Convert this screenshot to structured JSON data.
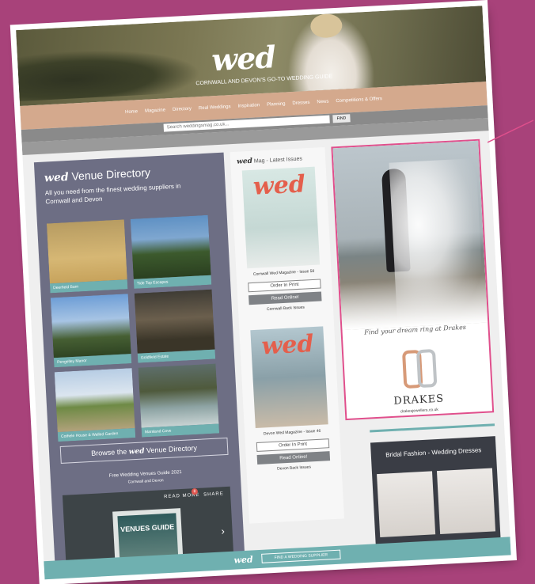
{
  "header": {
    "logo": "wed",
    "tagline": "CORNWALL AND DEVON'S GO-TO WEDDING GUIDE",
    "nav": [
      "Home",
      "Magazine",
      "Directory",
      "Real Weddings",
      "Inspiration",
      "Planning",
      "Dresses",
      "News",
      "Competitions & Offers"
    ],
    "search_placeholder": "Search weddingsmag.co.uk...",
    "find_label": "FIND"
  },
  "venue_directory": {
    "logo": "wed",
    "title": "Venue Directory",
    "subtitle": "All you need from the finest wedding suppliers in Cornwall and Devon",
    "venues": [
      "Deerfield Barn",
      "Tide Top Escapes",
      "Pengelley Manor",
      "Goldfield Estate",
      "Cothele House & Walled Garden",
      "Marsland Cove"
    ],
    "browse_prefix": "Browse the",
    "browse_logo": "wed",
    "browse_suffix": "Venue Directory",
    "guide_title": "Free Wedding Venues Guide 2021",
    "guide_sub": "Cornwall and Devon",
    "read_more": "READ MORE",
    "badge_count": "8",
    "share": "SHARE",
    "guide_cover_text": "VENUES GUIDE"
  },
  "magazine": {
    "logo": "wed",
    "title": "Mag - Latest Issues",
    "cover_mast": "wed",
    "issues": [
      {
        "name": "Cornwall Wed Magazine - Issue 58",
        "print": "Order In Print",
        "read": "Read Online!",
        "back": "Cornwall Back Issues"
      },
      {
        "name": "Devon Wed Magazine - Issue 46",
        "print": "Order In Print",
        "read": "Read Online!",
        "back": "Devon Back Issues"
      }
    ]
  },
  "ad": {
    "slogan": "Find your dream ring at Drakes",
    "brand": "DRAKES",
    "url": "drakesjewellers.co.uk"
  },
  "fashion": {
    "title": "Bridal Fashion - Wedding Dresses"
  },
  "footer": {
    "logo": "wed",
    "button": "FIND A WEDDING SUPPLIER"
  },
  "colors": {
    "background": "#a8427a",
    "accent_teal": "#6fb0b0",
    "ad_border": "#e04f8c",
    "nav_tan": "#d4a98d",
    "directory_panel": "#6d6e84"
  }
}
